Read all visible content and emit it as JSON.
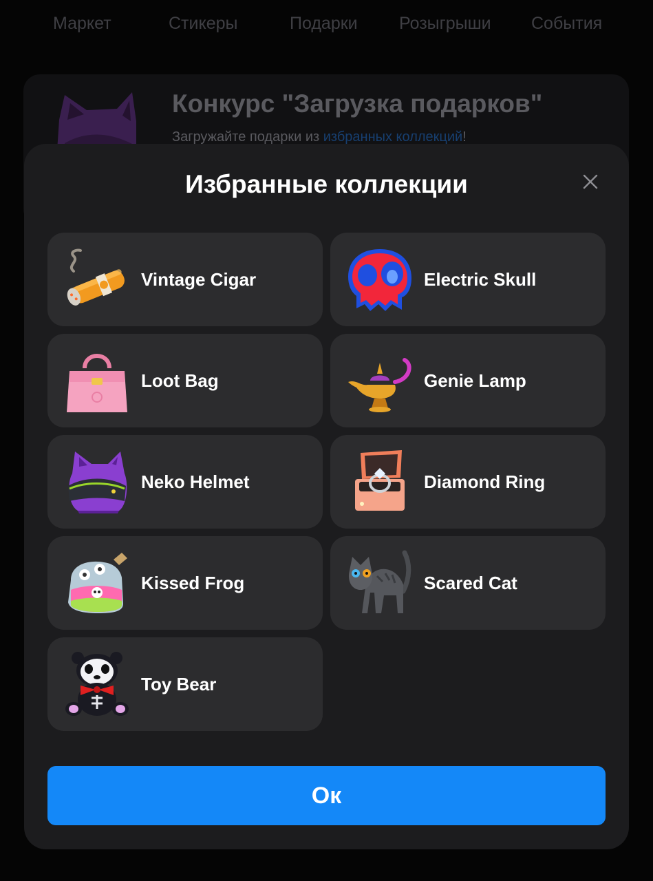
{
  "topnav": {
    "items": [
      "Маркет",
      "Стикеры",
      "Подарки",
      "Розыгрыши",
      "События"
    ]
  },
  "contest_card": {
    "title": "Конкурс \"Загрузка подарков\"",
    "subtitle_prefix": "Загружайте подарки из ",
    "subtitle_link": "избранных коллекций",
    "subtitle_suffix": "!"
  },
  "modal": {
    "title": "Избранные коллекции",
    "close_icon": "close-icon",
    "collections": [
      {
        "label": "Vintage Cigar",
        "icon": "cigar-icon"
      },
      {
        "label": "Electric Skull",
        "icon": "skull-icon"
      },
      {
        "label": "Loot Bag",
        "icon": "bag-icon"
      },
      {
        "label": "Genie Lamp",
        "icon": "lamp-icon"
      },
      {
        "label": "Neko Helmet",
        "icon": "helmet-icon"
      },
      {
        "label": "Diamond Ring",
        "icon": "ring-icon"
      },
      {
        "label": "Kissed Frog",
        "icon": "potion-icon"
      },
      {
        "label": "Scared Cat",
        "icon": "cat-icon"
      },
      {
        "label": "Toy Bear",
        "icon": "bear-icon"
      }
    ],
    "ok_label": "Ок"
  },
  "colors": {
    "background": "#050505",
    "modal": "#1c1c1e",
    "item": "#2c2c2e",
    "accent": "#1488f8"
  }
}
